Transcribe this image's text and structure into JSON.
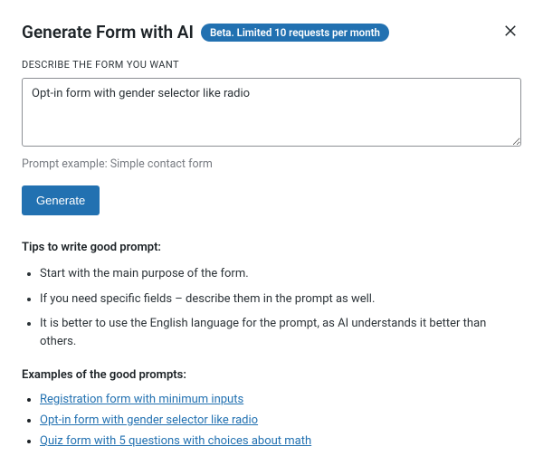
{
  "header": {
    "title": "Generate Form with AI",
    "badge": "Beta. Limited 10 requests per month"
  },
  "form": {
    "label": "DESCRIBE THE FORM YOU WANT",
    "value": "Opt-in form with gender selector like radio",
    "hint": "Prompt example: Simple contact form",
    "submit_label": "Generate"
  },
  "tips": {
    "title": "Tips to write good prompt:",
    "items": [
      "Start with the main purpose of the form.",
      "If you need specific fields – describe them in the prompt as well.",
      "It is better to use the English language for the prompt, as AI understands it better than others."
    ]
  },
  "examples": {
    "title": "Examples of the good prompts:",
    "items": [
      "Registration form with minimum inputs",
      "Opt-in form with gender selector like radio",
      "Quiz form with 5 questions with choices about math"
    ]
  }
}
